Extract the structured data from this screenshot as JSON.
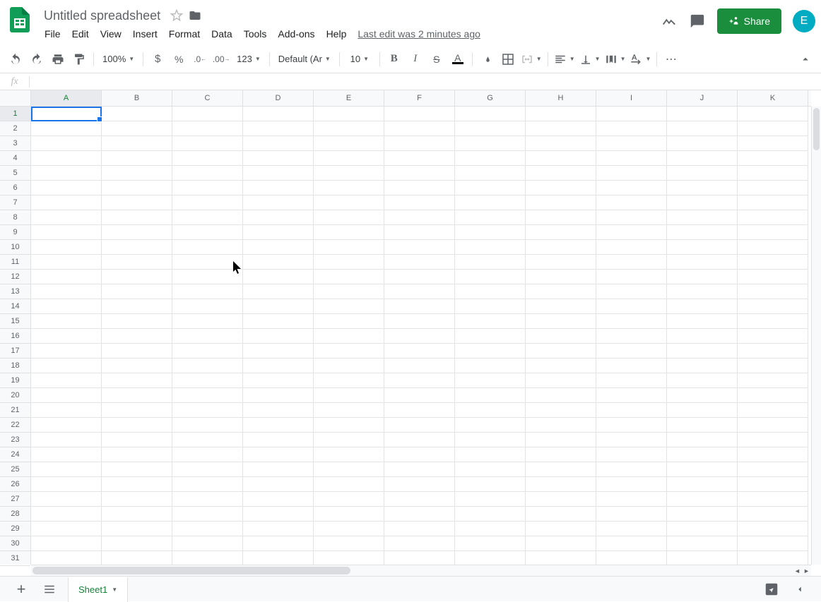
{
  "header": {
    "title": "Untitled spreadsheet",
    "last_edit": "Last edit was 2 minutes ago",
    "share_label": "Share",
    "avatar_initial": "E"
  },
  "menubar": {
    "items": [
      "File",
      "Edit",
      "View",
      "Insert",
      "Format",
      "Data",
      "Tools",
      "Add-ons",
      "Help"
    ]
  },
  "toolbar": {
    "zoom": "100%",
    "format_auto": "123",
    "font": "Default (Ari...",
    "font_size": "10"
  },
  "formula_bar": {
    "fx_label": "fx",
    "value": ""
  },
  "grid": {
    "columns": [
      "A",
      "B",
      "C",
      "D",
      "E",
      "F",
      "G",
      "H",
      "I",
      "J",
      "K"
    ],
    "rows": [
      "1",
      "2",
      "3",
      "4",
      "5",
      "6",
      "7",
      "8",
      "9",
      "10",
      "11",
      "12",
      "13",
      "14",
      "15",
      "16",
      "17",
      "18",
      "19",
      "20",
      "21",
      "22",
      "23",
      "24",
      "25",
      "26",
      "27",
      "28",
      "29",
      "30",
      "31"
    ],
    "active_cell": "A1"
  },
  "sheetbar": {
    "active_sheet": "Sheet1"
  }
}
